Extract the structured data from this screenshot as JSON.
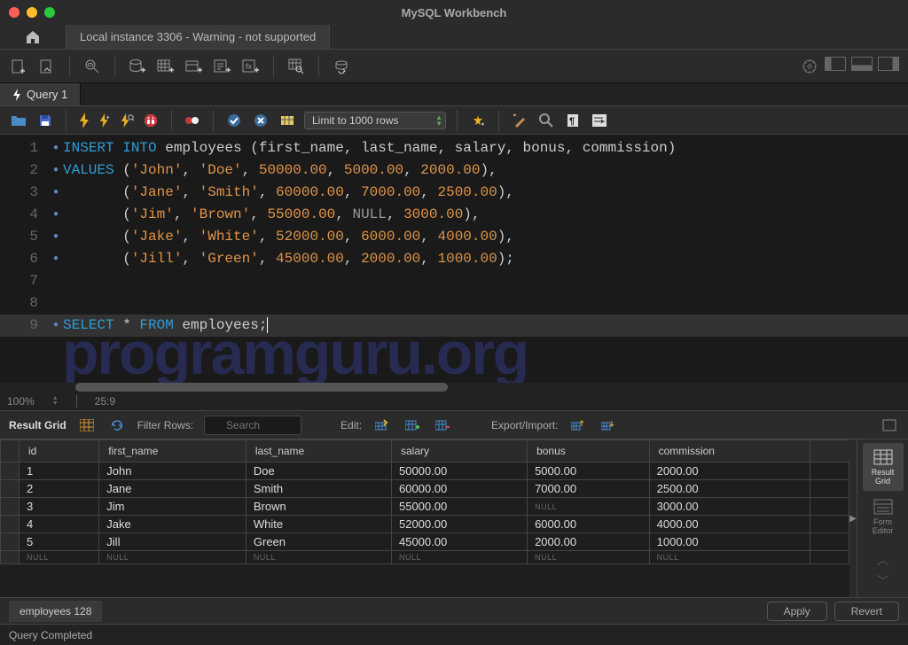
{
  "window": {
    "title": "MySQL Workbench"
  },
  "connection_tab": "Local instance 3306 - Warning - not supported",
  "query_tab": "Query 1",
  "limit_selector": "Limit to 1000 rows",
  "sql_lines": [
    "INSERT INTO employees (first_name, last_name, salary, bonus, commission)",
    "VALUES ('John', 'Doe', 50000.00, 5000.00, 2000.00),",
    "       ('Jane', 'Smith', 60000.00, 7000.00, 2500.00),",
    "       ('Jim', 'Brown', 55000.00, NULL, 3000.00),",
    "       ('Jake', 'White', 52000.00, 6000.00, 4000.00),",
    "       ('Jill', 'Green', 45000.00, 2000.00, 1000.00);",
    "",
    "",
    "SELECT * FROM employees;"
  ],
  "zoom": "100%",
  "cursor_pos": "25:9",
  "result_toolbar": {
    "grid_label": "Result Grid",
    "filter_label": "Filter Rows:",
    "search_placeholder": "Search",
    "edit_label": "Edit:",
    "export_label": "Export/Import:"
  },
  "columns": [
    "id",
    "first_name",
    "last_name",
    "salary",
    "bonus",
    "commission"
  ],
  "rows": [
    [
      "1",
      "John",
      "Doe",
      "50000.00",
      "5000.00",
      "2000.00"
    ],
    [
      "2",
      "Jane",
      "Smith",
      "60000.00",
      "7000.00",
      "2500.00"
    ],
    [
      "3",
      "Jim",
      "Brown",
      "55000.00",
      "NULL",
      "3000.00"
    ],
    [
      "4",
      "Jake",
      "White",
      "52000.00",
      "6000.00",
      "4000.00"
    ],
    [
      "5",
      "Jill",
      "Green",
      "45000.00",
      "2000.00",
      "1000.00"
    ]
  ],
  "side_panel": {
    "result_grid": "Result\nGrid",
    "form_editor": "Form\nEditor"
  },
  "result_tab": "employees 128",
  "buttons": {
    "apply": "Apply",
    "revert": "Revert"
  },
  "status": "Query Completed",
  "watermark": "programguru.org"
}
